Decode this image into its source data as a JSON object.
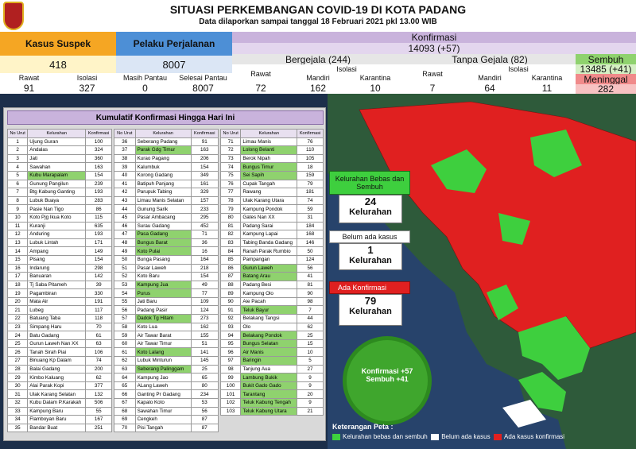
{
  "title": "SITUASI PERKEMBANGAN COVID-19 DI KOTA PADANG",
  "subtitle": "Data dilaporkan sampai tanggal 18 Februari 2021 pkl 13.00 WIB",
  "suspek": {
    "label": "Kasus Suspek",
    "total": "418",
    "rawat_label": "Rawat",
    "rawat": "91",
    "isolasi_label": "Isolasi",
    "isolasi": "327"
  },
  "perjalanan": {
    "label": "Pelaku Perjalanan",
    "total": "8007",
    "pantau_label": "Masih Pantau",
    "pantau": "0",
    "selesai_label": "Selesai Pantau",
    "selesai": "8007"
  },
  "konfirmasi": {
    "label": "Konfirmasi",
    "total": "14093 (+57)"
  },
  "bergejala": {
    "label": "Bergejala (244)",
    "rawat_label": "Rawat",
    "rawat": "72",
    "isolasi_label": "Isolasi",
    "mandiri_label": "Mandiri",
    "mandiri": "162",
    "karantina_label": "Karantina",
    "karantina": "10"
  },
  "tanpa_gejala": {
    "label": "Tanpa Gejala (82)",
    "rawat_label": "Rawat",
    "rawat": "7",
    "isolasi_label": "Isolasi",
    "mandiri_label": "Mandiri",
    "mandiri": "64",
    "karantina_label": "Karantina",
    "karantina": "11"
  },
  "sembuh": {
    "label": "Sembuh",
    "total": "13485 (+41)"
  },
  "meninggal": {
    "label": "Meninggal",
    "total": "282"
  },
  "kumulatif_title": "Kumulatif Konfirmasi Hingga Hari Ini",
  "table_headers": {
    "no": "No Urut",
    "kel": "Kelurahan",
    "konf": "Konfirmasi"
  },
  "map_labels": {
    "bebas_title": "Kelurahan Bebas dan Sembuh",
    "bebas_count": "24",
    "bebas_unit": "Kelurahan",
    "belum_title": "Belum ada kasus",
    "belum_count": "1",
    "belum_unit": "Kelurahan",
    "ada_title": "Ada Konfirmasi",
    "ada_count": "79",
    "ada_unit": "Kelurahan",
    "virus_line1": "Konfirmasi +57",
    "virus_line2": "Sembuh +41",
    "legend_title": "Keterangan Peta :",
    "legend_green": "Kelurahan bebas dan sembuh",
    "legend_white": "Belum ada kasus",
    "legend_red": "Ada kasus konfirmasi"
  },
  "colors": {
    "green": "#3ecf3e",
    "red": "#e02020",
    "white": "#ffffff",
    "header_purple": "#c9b3dc",
    "header_orange": "#f5a623",
    "header_blue": "#4d8fd6"
  },
  "chart_data": {
    "type": "table",
    "title": "Kumulatif Konfirmasi Hingga Hari Ini",
    "columns": [
      "No Urut",
      "Kelurahan",
      "Konfirmasi"
    ],
    "rows": [
      [
        1,
        "Ujung Guran",
        100
      ],
      [
        2,
        "Andalas",
        324
      ],
      [
        3,
        "Jati",
        360
      ],
      [
        4,
        "Sawahan",
        163
      ],
      [
        5,
        "Kubu Marapalam",
        154
      ],
      [
        6,
        "Gunung Pangilun",
        239
      ],
      [
        7,
        "Btg Kabung Ganting",
        193
      ],
      [
        8,
        "Lubuk Buaya",
        283
      ],
      [
        9,
        "Pasie Nan Tigo",
        86
      ],
      [
        10,
        "Koto Pjg Ikua Koto",
        115
      ],
      [
        11,
        "Kuranji",
        635
      ],
      [
        12,
        "Anduring",
        193
      ],
      [
        13,
        "Lubuk Lintah",
        171
      ],
      [
        14,
        "Ampang",
        149
      ],
      [
        15,
        "Pisang",
        154
      ],
      [
        16,
        "Indarung",
        298
      ],
      [
        17,
        "Banuaran",
        142
      ],
      [
        18,
        "Tj Saba Pitameh",
        39
      ],
      [
        19,
        "Pagambiran",
        330
      ],
      [
        20,
        "Mata Air",
        191
      ],
      [
        21,
        "Lubeg",
        117
      ],
      [
        22,
        "Batuang Taba",
        118
      ],
      [
        23,
        "Simpang Haru",
        70
      ],
      [
        24,
        "Batu Gadang",
        61
      ],
      [
        25,
        "Gurun Laweh Nan XX",
        63
      ],
      [
        26,
        "Tanah Sirah Piai",
        106
      ],
      [
        27,
        "Binuang Kp Dalam",
        74
      ],
      [
        28,
        "Balai Gadang",
        200
      ],
      [
        29,
        "Kimbo Kaluang",
        62
      ],
      [
        30,
        "Alai Parak Kopi",
        377
      ],
      [
        31,
        "Ulak Karang Selatan",
        132
      ],
      [
        32,
        "Kubu Dalam P.Karakah",
        506
      ],
      [
        33,
        "Kampung Baru",
        55
      ],
      [
        34,
        "Flamboyan Baru",
        167
      ],
      [
        35,
        "Bandar Buat",
        251
      ],
      [
        36,
        "Seberang Padang",
        91
      ],
      [
        37,
        "Parak Gdg Timur",
        163
      ],
      [
        38,
        "Kurao Pagang",
        206
      ],
      [
        39,
        "Kalumbuk",
        154
      ],
      [
        40,
        "Korong Gadang",
        349
      ],
      [
        41,
        "Batipuh Panjang",
        161
      ],
      [
        42,
        "Parupuk Tabing",
        329
      ],
      [
        43,
        "Limau Manis Selatan",
        157
      ],
      [
        44,
        "Gunung Sarik",
        233
      ],
      [
        45,
        "Pasar Ambacang",
        295
      ],
      [
        46,
        "Surau Gadang",
        452
      ],
      [
        47,
        "Pasa Gadang",
        71
      ],
      [
        48,
        "Bungus Barat",
        36
      ],
      [
        49,
        "Koto Pulai",
        16
      ],
      [
        50,
        "Bunga Pasang",
        164
      ],
      [
        51,
        "Pasar Laweh",
        218
      ],
      [
        52,
        "Koto Baru",
        154
      ],
      [
        53,
        "Kampung Jua",
        49
      ],
      [
        54,
        "Purus",
        77
      ],
      [
        55,
        "Jati Baru",
        109
      ],
      [
        56,
        "Padang Pasir",
        124
      ],
      [
        57,
        "Dadok Tg Hitam",
        273
      ],
      [
        58,
        "Koto Lua",
        162
      ],
      [
        59,
        "Air Tawar Barat",
        155
      ],
      [
        60,
        "Air Tawar Timur",
        51
      ],
      [
        61,
        "Koto Lalang",
        141
      ],
      [
        62,
        "Lubuk Minturun",
        145
      ],
      [
        63,
        "Seberang Palinggam",
        25
      ],
      [
        64,
        "Kampung Jao",
        65
      ],
      [
        65,
        "ALang Laweh",
        80
      ],
      [
        66,
        "Ganting Pr Gadang",
        234
      ],
      [
        67,
        "Kapalo Koto",
        53
      ],
      [
        68,
        "Sawahan Timur",
        56
      ],
      [
        69,
        "Cengkeh",
        87
      ],
      [
        70,
        "Pisi Tangah",
        87
      ],
      [
        71,
        "Limau Manis",
        76
      ],
      [
        72,
        "Lolong Belanti",
        110
      ],
      [
        73,
        "Berok Nipah",
        105
      ],
      [
        74,
        "Bungus Timur",
        18
      ],
      [
        75,
        "Sei Sapih",
        159
      ],
      [
        76,
        "Cupak Tangah",
        79
      ],
      [
        77,
        "Rawang",
        181
      ],
      [
        78,
        "Ulak Karang Utara",
        74
      ],
      [
        79,
        "Kampung Pondok",
        59
      ],
      [
        80,
        "Gates Nan XX",
        31
      ],
      [
        81,
        "Padang Sarai",
        184
      ],
      [
        82,
        "Kampung Lapai",
        168
      ],
      [
        83,
        "Tabing Banda Gadang",
        146
      ],
      [
        84,
        "Ranah Parak Rumbio",
        50
      ],
      [
        85,
        "Pampangan",
        124
      ],
      [
        86,
        "Gurun Laweh",
        56
      ],
      [
        87,
        "Batang Arau",
        41
      ],
      [
        88,
        "Padang Besi",
        81
      ],
      [
        89,
        "Kampung Olo",
        90
      ],
      [
        90,
        "Aie Pacah",
        98
      ],
      [
        91,
        "Teluk Bayur",
        7
      ],
      [
        92,
        "Belakang Tangsi",
        44
      ],
      [
        93,
        "Olo",
        62
      ],
      [
        94,
        "Belakang Pondok",
        25
      ],
      [
        95,
        "Bungus Selatan",
        15
      ],
      [
        96,
        "Air Manis",
        10
      ],
      [
        97,
        "Baringin",
        5
      ],
      [
        98,
        "Tanjung Aua",
        27
      ],
      [
        99,
        "Lambung Bukik",
        9
      ],
      [
        100,
        "Bukit Gado Gado",
        9
      ],
      [
        101,
        "Tarantang",
        20
      ],
      [
        102,
        "Teluk Kabung Tengah",
        9
      ],
      [
        103,
        "Teluk Kabung Utara",
        21
      ]
    ],
    "highlighted_green": [
      5,
      37,
      47,
      48,
      49,
      53,
      54,
      57,
      61,
      63,
      72,
      74,
      75,
      86,
      87,
      91,
      94,
      95,
      96,
      97,
      99,
      100,
      101,
      102,
      103
    ]
  }
}
